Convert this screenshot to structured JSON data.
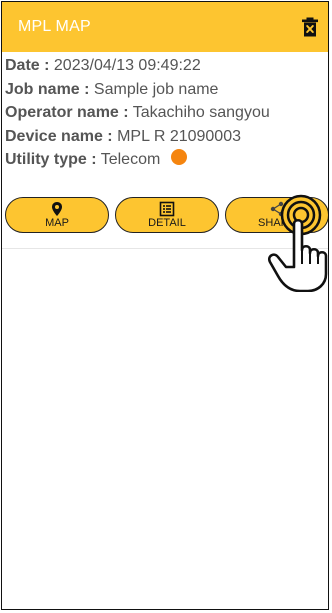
{
  "app_bar": {
    "title": "MPL MAP",
    "delete_icon": "trash-icon",
    "background_color": "#fdc530"
  },
  "info": {
    "date_label": "Date :",
    "date_value": "2023/04/13 09:49:22",
    "job_label": "Job name :",
    "job_value": "Sample job name",
    "operator_label": "Operator name :",
    "operator_value": "Takachiho sangyou",
    "device_label": "Device name :",
    "device_value": "MPL R 21090003",
    "utility_label": "Utility type :",
    "utility_value": "Telecom",
    "utility_color": "#f5850f"
  },
  "actions": [
    {
      "label": "MAP",
      "icon": "map-pin-icon"
    },
    {
      "label": "DETAIL",
      "icon": "list-detail-icon"
    },
    {
      "label": "SHARE",
      "icon": "share-icon"
    }
  ],
  "overlay": {
    "icon": "hand-pointer-icon"
  }
}
